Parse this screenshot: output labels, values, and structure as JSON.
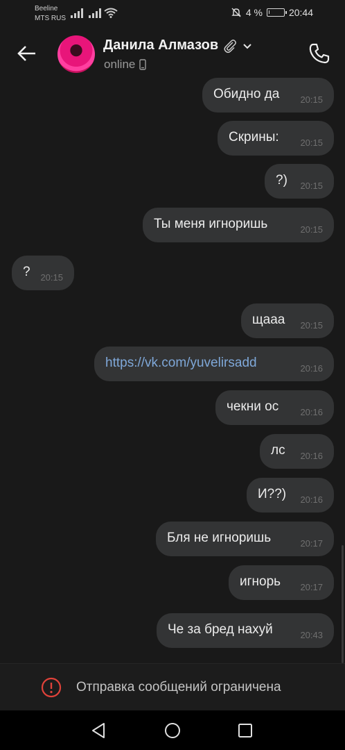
{
  "status_bar": {
    "carrier1": "Beeline",
    "carrier2": "MTS RUS",
    "battery_text": "4 %",
    "battery_level": 0.04,
    "time": "20:44",
    "icons": [
      "signal-icon",
      "signal-icon",
      "wifi-icon",
      "mute-icon",
      "battery-icon"
    ]
  },
  "header": {
    "contact_name": "Данила Алмазов",
    "status": "online",
    "icons": [
      "back-arrow-icon",
      "paperclip-icon",
      "chevron-down-icon",
      "mobile-icon",
      "phone-icon"
    ]
  },
  "messages": [
    {
      "text": "Обидно да",
      "time": "20:15",
      "outgoing": true
    },
    {
      "text": "Скрины:",
      "time": "20:15",
      "outgoing": true
    },
    {
      "text": "?)",
      "time": "20:15",
      "outgoing": true
    },
    {
      "text": "Ты меня игноришь",
      "time": "20:15",
      "outgoing": true
    },
    {
      "text": "?",
      "time": "20:15",
      "outgoing": false
    },
    {
      "text": "щааа",
      "time": "20:15",
      "outgoing": true
    },
    {
      "text": "https://vk.com/yuvelirsadd",
      "time": "20:16",
      "outgoing": true,
      "is_link": true
    },
    {
      "text": "чекни ос",
      "time": "20:16",
      "outgoing": true
    },
    {
      "text": "лс",
      "time": "20:16",
      "outgoing": true
    },
    {
      "text": "И??)",
      "time": "20:16",
      "outgoing": true
    },
    {
      "text": "Бля не игноришь",
      "time": "20:17",
      "outgoing": true
    },
    {
      "text": "игнорь",
      "time": "20:17",
      "outgoing": true
    },
    {
      "text": "Че за бред нахуй",
      "time": "20:43",
      "outgoing": true
    }
  ],
  "restriction": {
    "text": "Отправка сообщений ограничена",
    "icon": "alert-circle-icon",
    "color": "#e0423a"
  },
  "nav_bar": {
    "icons": [
      "back-triangle-icon",
      "home-circle-icon",
      "recents-square-icon"
    ]
  },
  "colors": {
    "background": "#191919",
    "bubble": "#333435",
    "link": "#7fa8d9"
  }
}
